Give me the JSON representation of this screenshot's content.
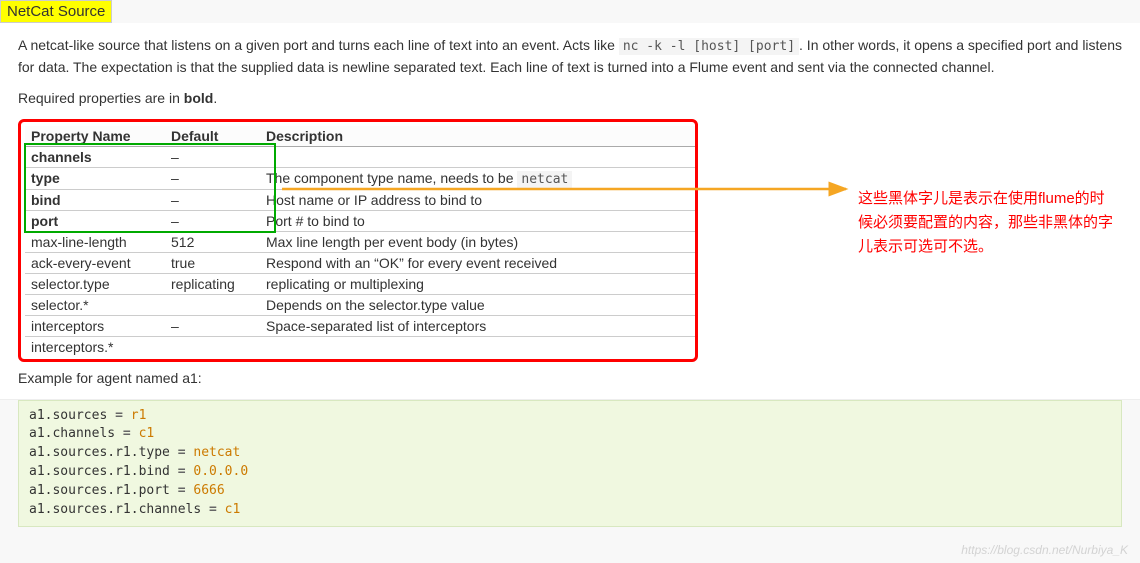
{
  "title": "NetCat Source",
  "intro_prefix": "A netcat-like source that listens on a given port and turns each line of text into an event. Acts like ",
  "intro_code": "nc -k -l [host] [port]",
  "intro_suffix": ". In other words, it opens a specified port and listens for data. The expectation is that the supplied data is newline separated text. Each line of text is turned into a Flume event and sent via the connected channel.",
  "req_note_prefix": "Required properties are in ",
  "req_note_bold": "bold",
  "req_note_suffix": ".",
  "table": {
    "headers": [
      "Property Name",
      "Default",
      "Description"
    ],
    "rows": [
      {
        "name": "channels",
        "bold": true,
        "default": "–",
        "desc_pre": "",
        "desc_code": "",
        "desc_post": ""
      },
      {
        "name": "type",
        "bold": true,
        "default": "–",
        "desc_pre": "The component type name, needs to be ",
        "desc_code": "netcat",
        "desc_post": ""
      },
      {
        "name": "bind",
        "bold": true,
        "default": "–",
        "desc_pre": "Host name or IP address to bind to",
        "desc_code": "",
        "desc_post": ""
      },
      {
        "name": "port",
        "bold": true,
        "default": "–",
        "desc_pre": "Port # to bind to",
        "desc_code": "",
        "desc_post": ""
      },
      {
        "name": "max-line-length",
        "bold": false,
        "default": "512",
        "desc_pre": "Max line length per event body (in bytes)",
        "desc_code": "",
        "desc_post": ""
      },
      {
        "name": "ack-every-event",
        "bold": false,
        "default": "true",
        "desc_pre": "Respond with an “OK” for every event received",
        "desc_code": "",
        "desc_post": ""
      },
      {
        "name": "selector.type",
        "bold": false,
        "default": "replicating",
        "desc_pre": "replicating or multiplexing",
        "desc_code": "",
        "desc_post": ""
      },
      {
        "name": "selector.*",
        "bold": false,
        "default": "",
        "desc_pre": "Depends on the selector.type value",
        "desc_code": "",
        "desc_post": ""
      },
      {
        "name": "interceptors",
        "bold": false,
        "default": "–",
        "desc_pre": "Space-separated list of interceptors",
        "desc_code": "",
        "desc_post": ""
      },
      {
        "name": "interceptors.*",
        "bold": false,
        "default": "",
        "desc_pre": "",
        "desc_code": "",
        "desc_post": ""
      }
    ]
  },
  "annotation": "这些黑体字儿是表示在使用flume的时候必须要配置的内容，那些非黑体的字儿表示可选可不选。",
  "example_label": "Example for agent named a1:",
  "code_lines": [
    {
      "lhs": "a1.sources",
      "op": " = ",
      "val": "r1"
    },
    {
      "lhs": "a1.channels",
      "op": " = ",
      "val": "c1"
    },
    {
      "lhs": "a1.sources.r1.type",
      "op": " = ",
      "val": "netcat"
    },
    {
      "lhs": "a1.sources.r1.bind",
      "op": " = ",
      "val": "0.0.0.0"
    },
    {
      "lhs": "a1.sources.r1.port",
      "op": " = ",
      "val": "6666"
    },
    {
      "lhs": "a1.sources.r1.channels",
      "op": " = ",
      "val": "c1"
    }
  ],
  "watermark": "https://blog.csdn.net/Nurbiya_K"
}
